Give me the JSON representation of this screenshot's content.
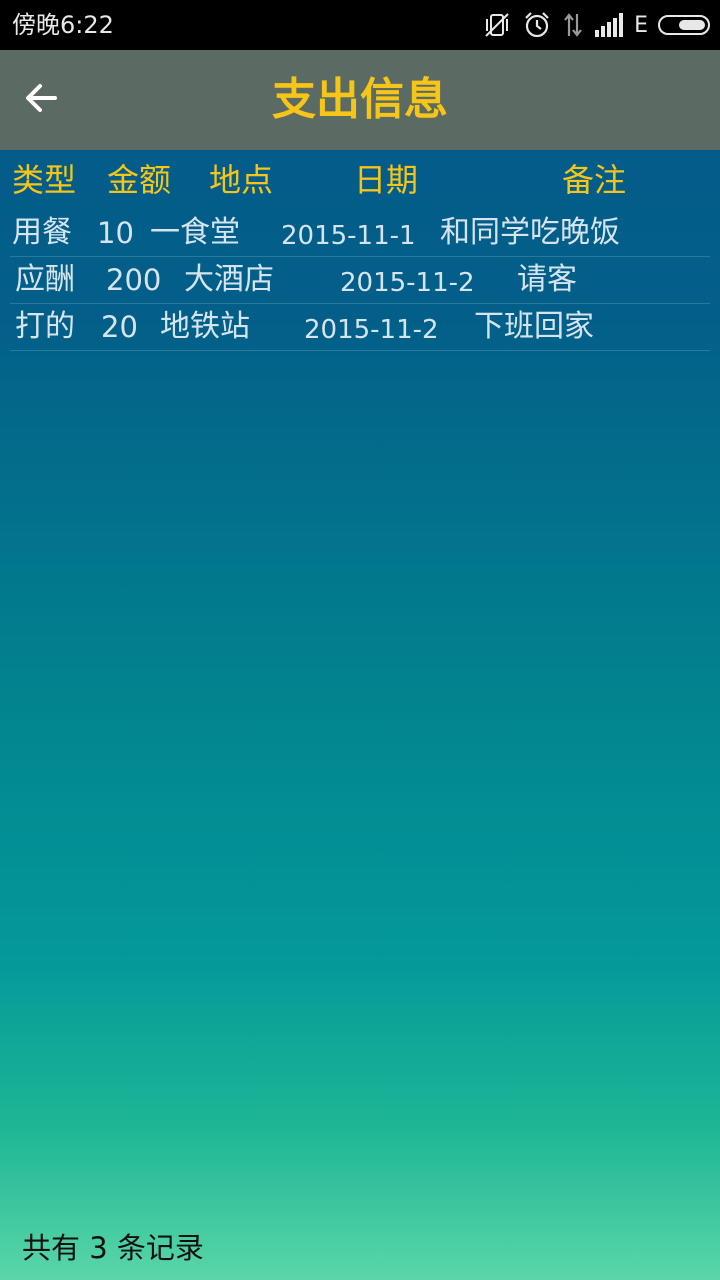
{
  "status_bar": {
    "time": "傍晚6:22",
    "network_label": "E",
    "icons": [
      "vibrate-off-icon",
      "alarm-icon",
      "data-activity-icon",
      "signal-icon",
      "battery-icon"
    ]
  },
  "app_bar": {
    "title": "支出信息",
    "back_icon": "arrow-left-icon"
  },
  "table": {
    "columns": [
      "类型",
      "金额",
      "地点",
      "日期",
      "备注"
    ],
    "rows": [
      {
        "type": "用餐",
        "amount": "10",
        "place": "一食堂",
        "date": "2015-11-1",
        "note": "和同学吃晚饭"
      },
      {
        "type": "应酬",
        "amount": "200",
        "place": "大酒店",
        "date": "2015-11-2",
        "note": "请客"
      },
      {
        "type": "打的",
        "amount": "20",
        "place": "地铁站",
        "date": "2015-11-2",
        "note": "下班回家"
      }
    ]
  },
  "footer": {
    "count_text": "共有 3 条记录"
  },
  "colors": {
    "title": "#f5c518",
    "header_text": "#f5c518",
    "row_text": "#d6e4ee",
    "app_bar_bg": "#5b6a62"
  }
}
